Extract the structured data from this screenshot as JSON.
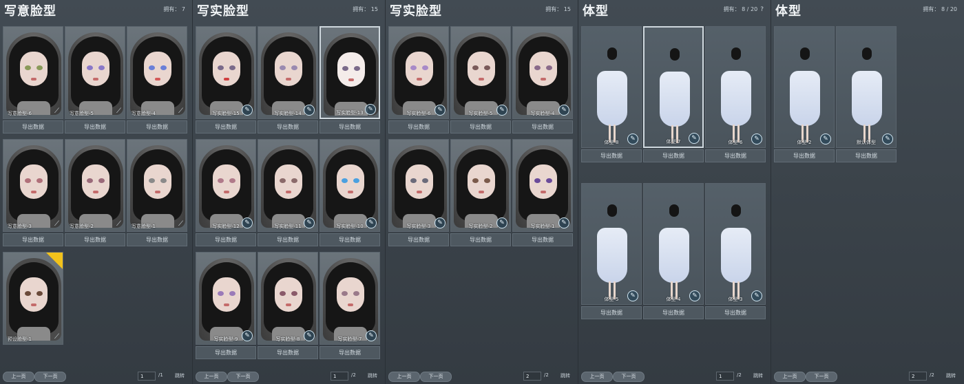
{
  "colors": {
    "accent": "#cfd8de",
    "badge": "#f2c21b"
  },
  "icons": {
    "edit": "brush-icon",
    "prev": "arrow-left-icon",
    "next": "arrow-right-icon"
  },
  "panels": [
    {
      "title": "写意脸型",
      "owned": "拥有： 7",
      "items": [
        "写意脸型-6",
        "写意脸型-5",
        "写意脸型-4",
        "写意脸型-3",
        "写意脸型-2",
        "写意脸型-1",
        "预设脸型-1"
      ],
      "export": "导出数据",
      "prev": "上一页",
      "next": "下一页",
      "page": "1",
      "total": "/1",
      "jump": "跳转"
    },
    {
      "title": "写实脸型",
      "owned": "拥有： 15",
      "items": [
        "写实脸型-15",
        "写实脸型-14",
        "写实脸型-13",
        "写实脸型-12",
        "写实脸型-11",
        "写实脸型-10",
        "写实脸型-9",
        "写实脸型-8",
        "写实脸型-7"
      ],
      "export": "导出数据",
      "prev": "上一页",
      "next": "下一页",
      "page": "1",
      "total": "/2",
      "jump": "跳转"
    },
    {
      "title": "写实脸型",
      "owned": "拥有： 15",
      "items": [
        "写实脸型-6",
        "写实脸型-5",
        "写实脸型-4",
        "写实脸型-3",
        "写实脸型-2",
        "写实脸型-1"
      ],
      "export": "导出数据",
      "prev": "上一页",
      "next": "下一页",
      "page": "2",
      "total": "/2",
      "jump": "跳转"
    },
    {
      "title": "体型",
      "owned": "拥有： 8 / 20",
      "help": "?",
      "items": [
        "体型-8",
        "体型-7",
        "体型-6",
        "体型-5",
        "体型-4",
        "体型-3"
      ],
      "export": "导出数据",
      "prev": "上一页",
      "next": "下一页",
      "page": "1",
      "total": "/2",
      "jump": "跳转"
    },
    {
      "title": "体型",
      "owned": "拥有： 8 / 20",
      "items": [
        "体型-2",
        "默认体型"
      ],
      "export": "导出数据",
      "prev": "上一页",
      "next": "下一页",
      "page": "2",
      "total": "/2",
      "jump": "跳转"
    }
  ]
}
